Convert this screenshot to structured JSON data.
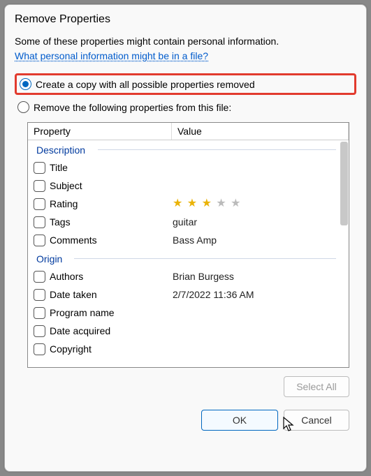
{
  "title": "Remove Properties",
  "intro_text": "Some of these properties might contain personal information.",
  "intro_link": "What personal information might be in a file?",
  "option_create_copy": "Create a copy with all possible properties removed",
  "option_remove_following": "Remove the following properties from this file:",
  "headers": {
    "property": "Property",
    "value": "Value"
  },
  "groups": {
    "description": {
      "label": "Description",
      "items": [
        {
          "name": "Title",
          "value": ""
        },
        {
          "name": "Subject",
          "value": ""
        },
        {
          "name": "Rating",
          "value": "3/5"
        },
        {
          "name": "Tags",
          "value": "guitar"
        },
        {
          "name": "Comments",
          "value": "Bass Amp"
        }
      ]
    },
    "origin": {
      "label": "Origin",
      "items": [
        {
          "name": "Authors",
          "value": "Brian Burgess"
        },
        {
          "name": "Date taken",
          "value": "2/7/2022 11:36 AM"
        },
        {
          "name": "Program name",
          "value": ""
        },
        {
          "name": "Date acquired",
          "value": ""
        },
        {
          "name": "Copyright",
          "value": ""
        }
      ]
    }
  },
  "buttons": {
    "select_all": "Select All",
    "ok": "OK",
    "cancel": "Cancel"
  }
}
